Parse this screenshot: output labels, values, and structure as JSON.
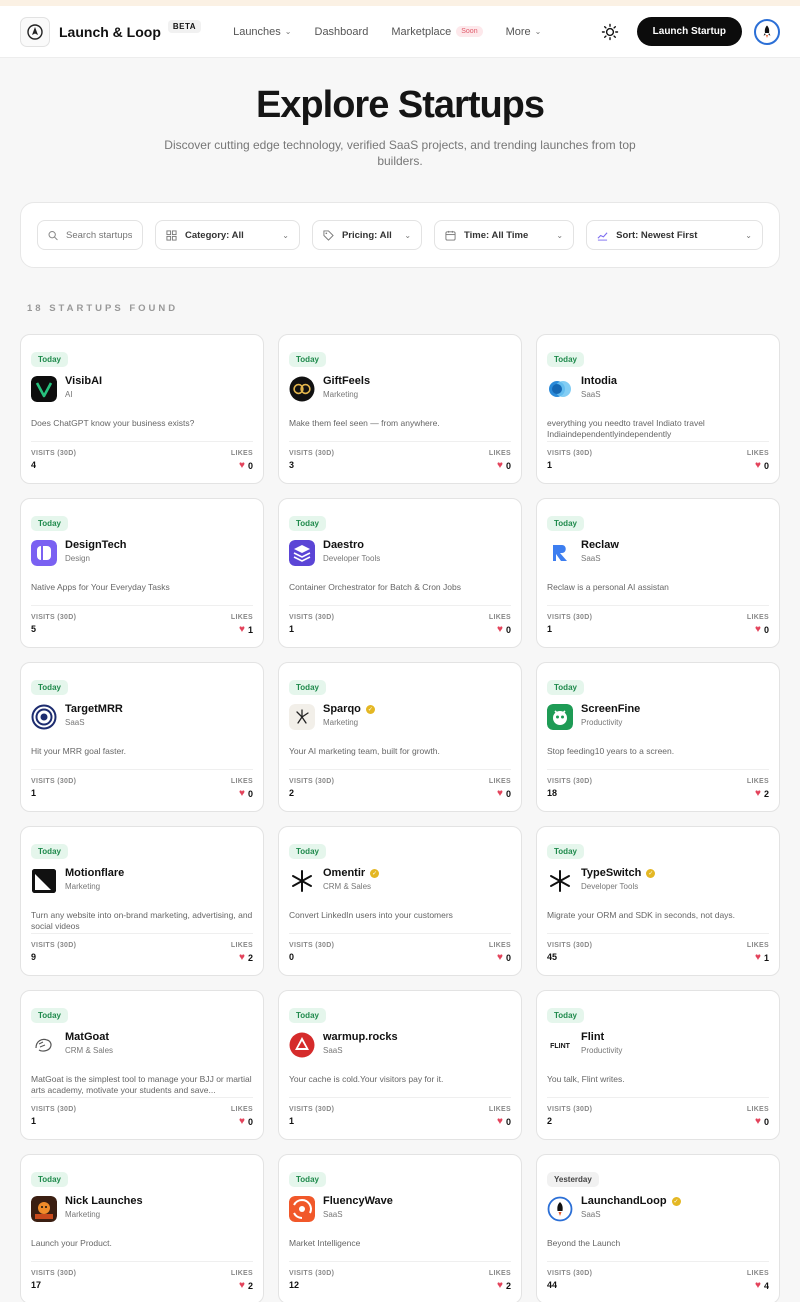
{
  "nav": {
    "brand": "Launch & Loop",
    "beta": "BETA",
    "links": [
      {
        "label": "Launches",
        "chevron": true
      },
      {
        "label": "Dashboard",
        "chevron": false
      },
      {
        "label": "Marketplace",
        "chevron": false,
        "tag": "Soon"
      },
      {
        "label": "More",
        "chevron": true
      }
    ],
    "launch_button": "Launch Startup"
  },
  "hero": {
    "title": "Explore Startups",
    "subtitle": "Discover cutting edge technology, verified SaaS projects, and trending launches from top builders."
  },
  "filters": {
    "search_placeholder": "Search startups",
    "category": "Category: All",
    "pricing": "Pricing: All",
    "time": "Time: All Time",
    "sort": "Sort: Newest First"
  },
  "results_count": "18 STARTUPS FOUND",
  "stat_labels": {
    "visits": "VISITS (30D)",
    "likes": "LIKES"
  },
  "colors": {
    "accent": "#0c0c0c",
    "badge_green": "#1f8a4c",
    "heart": "#e3435b",
    "verified": "#e4b723"
  },
  "cards": [
    {
      "badge": "Today",
      "name": "VisibAI",
      "category": "AI",
      "desc": "Does ChatGPT know your business exists?",
      "visits": "4",
      "likes": "0",
      "icon": "visibai-logo",
      "verified": false
    },
    {
      "badge": "Today",
      "name": "GiftFeels",
      "category": "Marketing",
      "desc": "Make them feel seen — from anywhere.",
      "visits": "3",
      "likes": "0",
      "icon": "giftfeels-logo",
      "verified": false
    },
    {
      "badge": "Today",
      "name": "Intodia",
      "category": "SaaS",
      "desc": "everything you needto travel Indiato travel Indiaindependentlyindependently",
      "visits": "1",
      "likes": "0",
      "icon": "intodia-logo",
      "verified": false
    },
    {
      "badge": "Today",
      "name": "DesignTech",
      "category": "Design",
      "desc": "Native Apps for Your Everyday Tasks",
      "visits": "5",
      "likes": "1",
      "icon": "designtech-logo",
      "verified": false
    },
    {
      "badge": "Today",
      "name": "Daestro",
      "category": "Developer Tools",
      "desc": "Container Orchestrator for Batch & Cron Jobs",
      "visits": "1",
      "likes": "0",
      "icon": "daestro-logo",
      "verified": false
    },
    {
      "badge": "Today",
      "name": "Reclaw",
      "category": "SaaS",
      "desc": "Reclaw is a personal AI assistan",
      "visits": "1",
      "likes": "0",
      "icon": "reclaw-logo",
      "verified": false
    },
    {
      "badge": "Today",
      "name": "TargetMRR",
      "category": "SaaS",
      "desc": "Hit your MRR goal faster.",
      "visits": "1",
      "likes": "0",
      "icon": "targetmrr-logo",
      "verified": false
    },
    {
      "badge": "Today",
      "name": "Sparqo",
      "category": "Marketing",
      "desc": "Your AI marketing team, built for growth.",
      "visits": "2",
      "likes": "0",
      "icon": "sparqo-logo",
      "verified": true
    },
    {
      "badge": "Today",
      "name": "ScreenFine",
      "category": "Productivity",
      "desc": "Stop feeding10 years to a screen.",
      "visits": "18",
      "likes": "2",
      "icon": "screenfine-logo",
      "verified": false
    },
    {
      "badge": "Today",
      "name": "Motionflare",
      "category": "Marketing",
      "desc": "Turn any website into on-brand marketing, advertising, and social videos",
      "visits": "9",
      "likes": "2",
      "icon": "motionflare-logo",
      "verified": false
    },
    {
      "badge": "Today",
      "name": "Omentir",
      "category": "CRM & Sales",
      "desc": "Convert LinkedIn users into your customers",
      "visits": "0",
      "likes": "0",
      "icon": "omentir-logo",
      "verified": true
    },
    {
      "badge": "Today",
      "name": "TypeSwitch",
      "category": "Developer Tools",
      "desc": "Migrate your ORM and SDK in seconds, not days.",
      "visits": "45",
      "likes": "1",
      "icon": "typeswitch-logo",
      "verified": true
    },
    {
      "badge": "Today",
      "name": "MatGoat",
      "category": "CRM & Sales",
      "desc": "MatGoat is the simplest tool to manage your BJJ or martial arts academy, motivate your students and save...",
      "visits": "1",
      "likes": "0",
      "icon": "matgoat-logo",
      "verified": false
    },
    {
      "badge": "Today",
      "name": "warmup.rocks",
      "category": "SaaS",
      "desc": "Your cache is cold.Your visitors pay for it.",
      "visits": "1",
      "likes": "0",
      "icon": "warmup-logo",
      "verified": false
    },
    {
      "badge": "Today",
      "name": "Flint",
      "category": "Productivity",
      "desc": "You talk, Flint writes.",
      "visits": "2",
      "likes": "0",
      "icon": "flint-logo",
      "verified": false,
      "icon_text": "FLINT"
    },
    {
      "badge": "Today",
      "name": "Nick Launches",
      "category": "Marketing",
      "desc": "Launch your Product.",
      "visits": "17",
      "likes": "2",
      "icon": "nicklaunches-logo",
      "verified": false
    },
    {
      "badge": "Today",
      "name": "FluencyWave",
      "category": "SaaS",
      "desc": "Market Intelligence",
      "visits": "12",
      "likes": "2",
      "icon": "fluencywave-logo",
      "verified": false
    },
    {
      "badge": "Yesterday",
      "name": "LaunchandLoop",
      "category": "SaaS",
      "desc": "Beyond the Launch",
      "visits": "44",
      "likes": "4",
      "icon": "launchandloop-logo",
      "verified": true
    }
  ]
}
